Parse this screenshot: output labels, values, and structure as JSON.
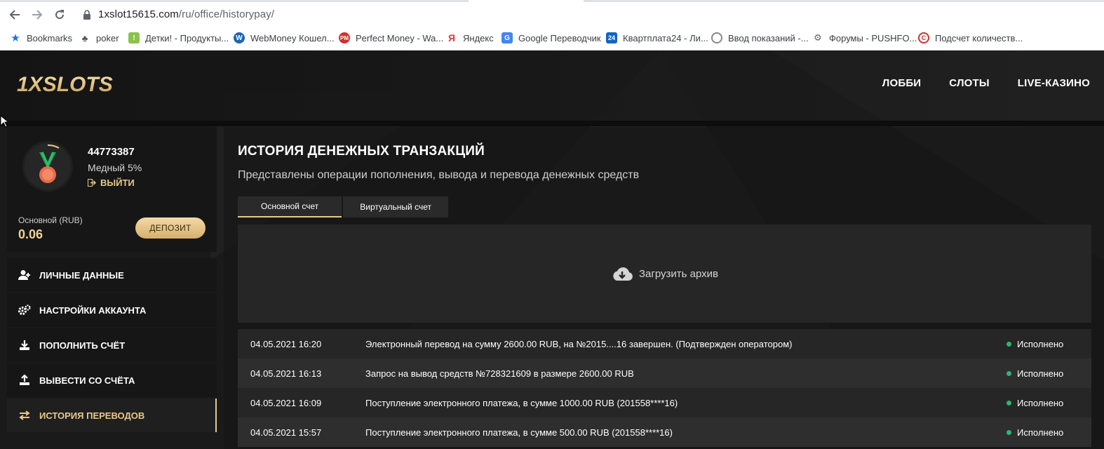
{
  "browser": {
    "url_host": "1xslot15615.com",
    "url_path": "/ru/office/historypay/",
    "bookmarks": [
      {
        "label": "Bookmarks",
        "icon": "star-icon"
      },
      {
        "label": "poker",
        "icon": "poker-icon"
      },
      {
        "label": "Детки! - Продукты...",
        "icon": "deti-icon"
      },
      {
        "label": "WebMoney Кошел...",
        "icon": "webmoney-icon"
      },
      {
        "label": "Perfect Money - Wa...",
        "icon": "perfectmoney-icon"
      },
      {
        "label": "Яндекс",
        "icon": "yandex-icon"
      },
      {
        "label": "Google Переводчик",
        "icon": "google-translate-icon"
      },
      {
        "label": "Квартплата24 - Ли...",
        "icon": "kvartplata-icon"
      },
      {
        "label": "Ввод показаний -...",
        "icon": "meter-icon"
      },
      {
        "label": "Форумы - PUSHFO...",
        "icon": "forum-icon"
      },
      {
        "label": "Подсчет количеств...",
        "icon": "copyright-icon"
      }
    ]
  },
  "header": {
    "logo_text": "1XSLOTS",
    "nav": [
      "ЛОББИ",
      "СЛОТЫ",
      "LIVE-КАЗИНО"
    ]
  },
  "profile": {
    "user_id": "44773387",
    "level": "Медный 5%",
    "logout_label": "ВЫЙТИ",
    "balance_label": "Основной (RUB)",
    "balance_value": "0.06",
    "deposit_label": "ДЕПОЗИТ"
  },
  "menu": [
    {
      "label": "ЛИЧНЫЕ ДАННЫЕ",
      "icon": "user-add-icon"
    },
    {
      "label": "НАСТРОЙКИ АККАУНТА",
      "icon": "gears-icon"
    },
    {
      "label": "ПОПОЛНИТЬ СЧЁТ",
      "icon": "download-icon"
    },
    {
      "label": "ВЫВЕСТИ СО СЧЁТА",
      "icon": "upload-icon"
    },
    {
      "label": "ИСТОРИЯ ПЕРЕВОДОВ",
      "icon": "transfer-arrows-icon"
    }
  ],
  "main": {
    "title": "ИСТОРИЯ ДЕНЕЖНЫХ ТРАНЗАКЦИЙ",
    "subtitle": "Представлены операции пополнения, вывода и перевода денежных средств",
    "tabs": [
      "Основной счет",
      "Виртуальный счет"
    ],
    "archive_label": "Загрузить архив",
    "transactions": [
      {
        "date": "04.05.2021 16:20",
        "description": "Электронный перевод на сумму 2600.00 RUB, на №2015....16 завершен. (Подтвержден оператором)",
        "status": "Исполнено"
      },
      {
        "date": "04.05.2021 16:13",
        "description": "Запрос на вывод средств №728321609 в размере 2600.00 RUB",
        "status": "Исполнено"
      },
      {
        "date": "04.05.2021 16:09",
        "description": "Поступление электронного платежа, в сумме 1000.00 RUB (201558****16)",
        "status": "Исполнено"
      },
      {
        "date": "04.05.2021 15:57",
        "description": "Поступление электронного платежа, в сумме 500.00 RUB (201558****16)",
        "status": "Исполнено"
      }
    ]
  },
  "colors": {
    "accent_gold": "#e8c98a",
    "status_green": "#2bb673",
    "panel_dark": "#161616"
  }
}
